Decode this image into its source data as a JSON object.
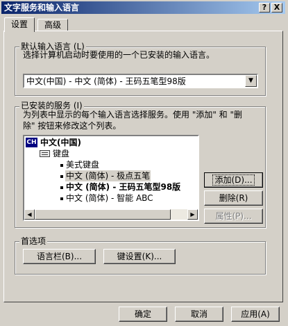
{
  "window": {
    "title": "文字服务和输入语言",
    "help_btn": "?",
    "close_btn": "X"
  },
  "tabs": [
    {
      "label": "设置",
      "active": true
    },
    {
      "label": "高级",
      "active": false
    }
  ],
  "default_lang": {
    "legend": "默认输入语言 (L)",
    "description": "选择计算机启动时要使用的一个已安装的输入语言。",
    "selected": "中文(中国) - 中文 (简体) - 王码五笔型98版"
  },
  "installed": {
    "legend": "已安装的服务 (I)",
    "description_1": "为列表中显示的每个输入语言选择服务。使用 \"添加\" 和 \"删",
    "description_2": "除\" 按钮来修改这个列表。",
    "lang_badge": "CH",
    "lang_name": "中文(中国)",
    "category": "键盘",
    "items": [
      "美式键盘",
      "中文 (简体) - 极点五笔",
      "中文 (简体) - 王码五笔型98版",
      "中文 (简体) - 智能 ABC"
    ],
    "add_btn": "添加(D)...",
    "remove_btn": "删除(R)",
    "props_btn": "属性(P)..."
  },
  "prefs": {
    "legend": "首选项",
    "langbar_btn": "语言栏(B)...",
    "keyset_btn": "键设置(K)..."
  },
  "footer": {
    "ok": "确定",
    "cancel": "取消",
    "apply": "应用(A)"
  }
}
